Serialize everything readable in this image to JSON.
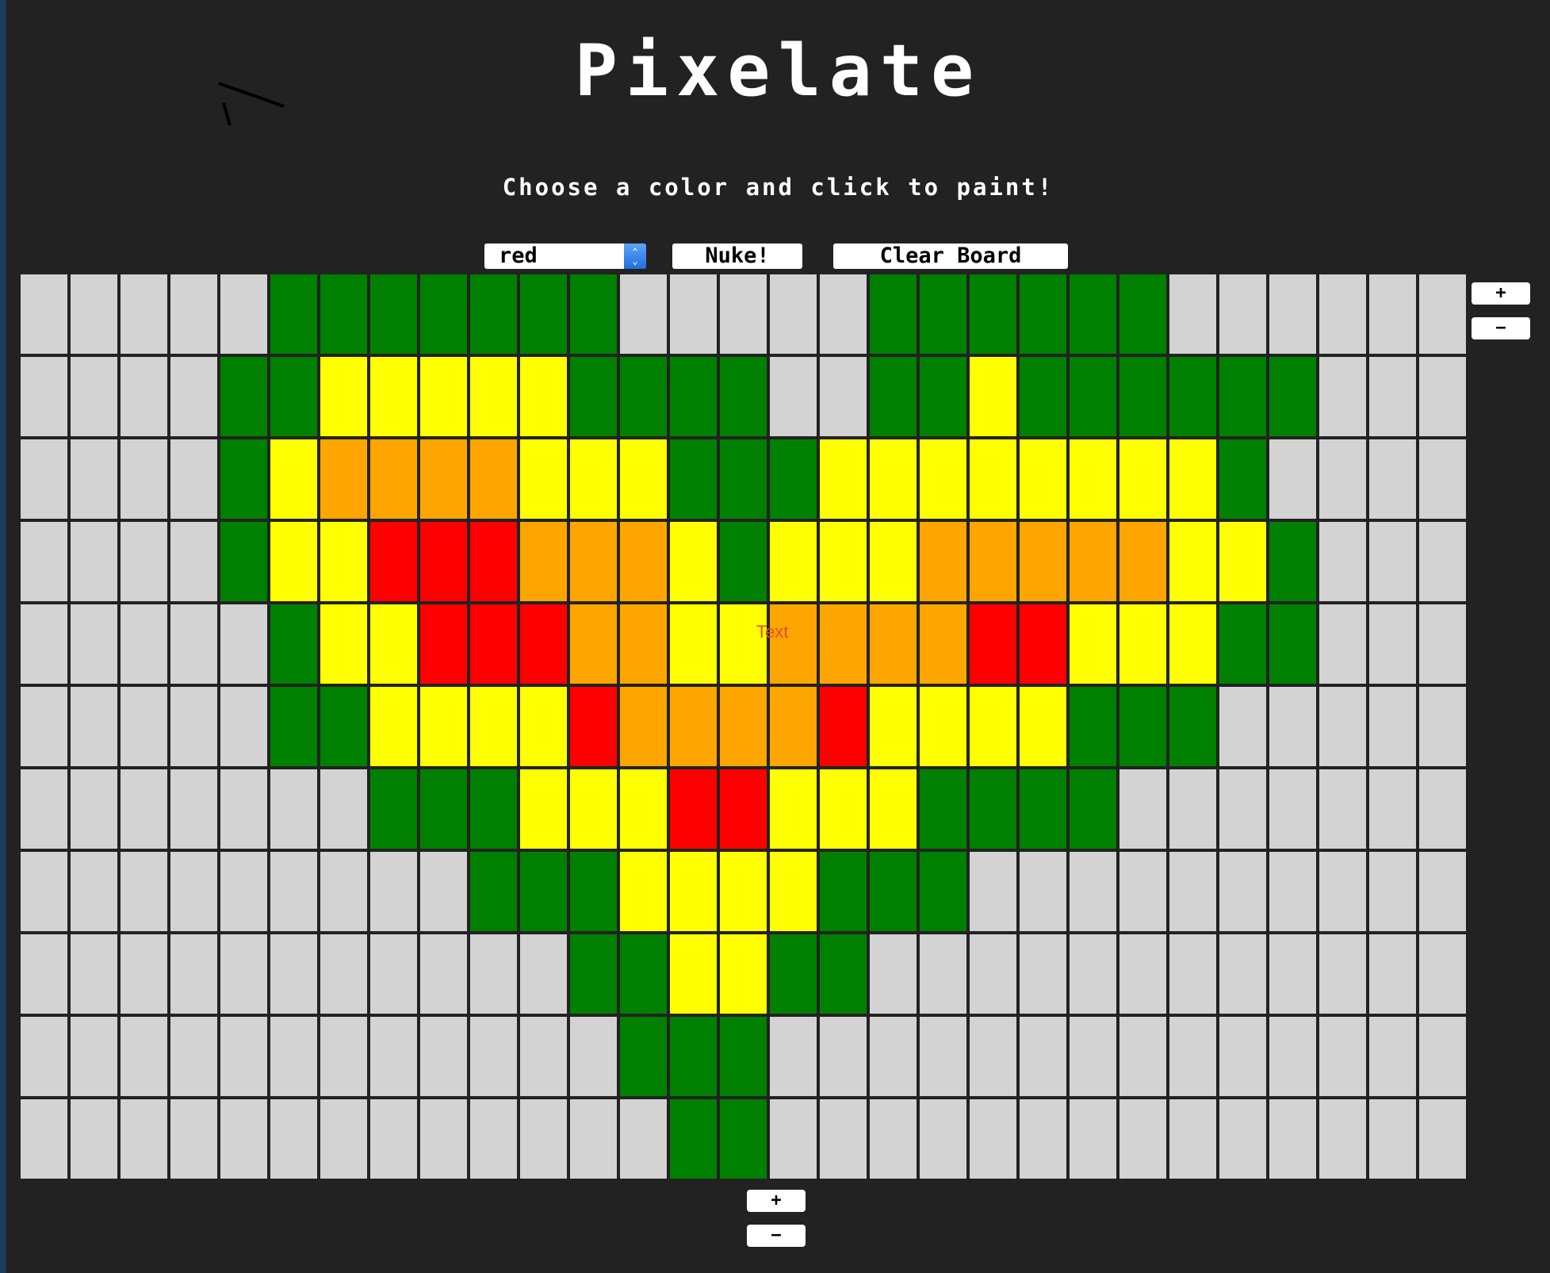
{
  "app": {
    "title": "Pixelate",
    "subtitle": "Choose a color and click to paint!"
  },
  "controls": {
    "color_select_value": "red",
    "nuke_label": "Nuke!",
    "clear_label": "Clear Board"
  },
  "side_buttons": {
    "add_column_label": "+",
    "remove_column_label": "−"
  },
  "bottom_buttons": {
    "add_row_label": "+",
    "remove_row_label": "−"
  },
  "overlay_text": "Text",
  "palette": {
    "G": "#d3d3d3",
    "g": "#008000",
    "y": "#ffff00",
    "o": "#ffa500",
    "r": "#ff0000"
  },
  "grid": {
    "columns": 29,
    "rows": [
      "GGGGGgggggggGGGGGggggggGGGGGG",
      "GGGGggyyyyyggggGGggyggggggGGGG",
      "GGGGgyooooyyygggyyyyyyyygGGGG",
      "GGGGgyyrrroooygyyyoooooyygGGG",
      "GGGGGgyyrrrooyyoooorryyyggGGG",
      "GGGGGggyyyyrooooryyyygggGGGGG",
      "GGGGGGGgggyyyrryyyggggGGGGGGG",
      "GGGGGGGGGgggyyyygggGGGGGGGGGG",
      "GGGGGGGGGGGggyyggGGGGGGGGGGGG",
      "GGGGGGGGGGGGgggGGGGGGGGGGGGGG",
      "GGGGGGGGGGGGGggGGGGGGGGGGGGGG"
    ]
  }
}
